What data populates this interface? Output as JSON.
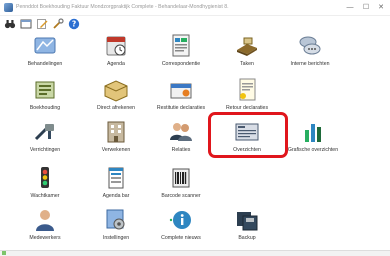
{
  "window": {
    "title": "Pennddot Boekhouding Faktuur Mondzorgpraktijk Complete - Behandelaar-Mondhygienist 8.",
    "minimize": "—",
    "maximize": "☐",
    "close": "✕"
  },
  "toolbar": {
    "items": [
      "binoculars-icon",
      "window-icon",
      "edit-icon",
      "tools-icon",
      "help-icon"
    ]
  },
  "tiles": [
    {
      "label": "Behandelingen",
      "icon": "treatment-icon"
    },
    {
      "label": "Agenda",
      "icon": "calendar-icon"
    },
    {
      "label": "Correspondentie",
      "icon": "documents-icon"
    },
    {
      "label": "Taken",
      "icon": "tasks-icon"
    },
    {
      "label": "Interne berichten",
      "icon": "messages-icon"
    },
    {
      "label": "Boekhouding",
      "icon": "accounting-icon"
    },
    {
      "label": "Direct afrekenen",
      "icon": "checkout-icon"
    },
    {
      "label": "Restitutie declaraties",
      "icon": "refund-icon"
    },
    {
      "label": "Retour declaraties",
      "icon": "returns-icon"
    },
    {
      "label": "Verrichtingen",
      "icon": "procedures-icon"
    },
    {
      "label": "Verwekenen",
      "icon": "building-icon"
    },
    {
      "label": "Relaties",
      "icon": "people-icon"
    },
    {
      "label": "Overzichten",
      "icon": "overview-icon"
    },
    {
      "label": "Grafische overzichten",
      "icon": "bar-chart-icon"
    },
    {
      "label": "Wachtkamer",
      "icon": "traffic-light-icon"
    },
    {
      "label": "Agenda bar",
      "icon": "agenda-bar-icon"
    },
    {
      "label": "Barcode scanner",
      "icon": "barcode-icon"
    },
    {
      "label": "Medewerkers",
      "icon": "staff-icon"
    },
    {
      "label": "Instellingen",
      "icon": "settings-icon"
    },
    {
      "label": "Complete nieuws",
      "icon": "info-icon"
    },
    {
      "label": "Backup",
      "icon": "backup-icon"
    }
  ],
  "colors": {
    "highlight": "#e0161c",
    "status_grip": "#7dc46a"
  }
}
